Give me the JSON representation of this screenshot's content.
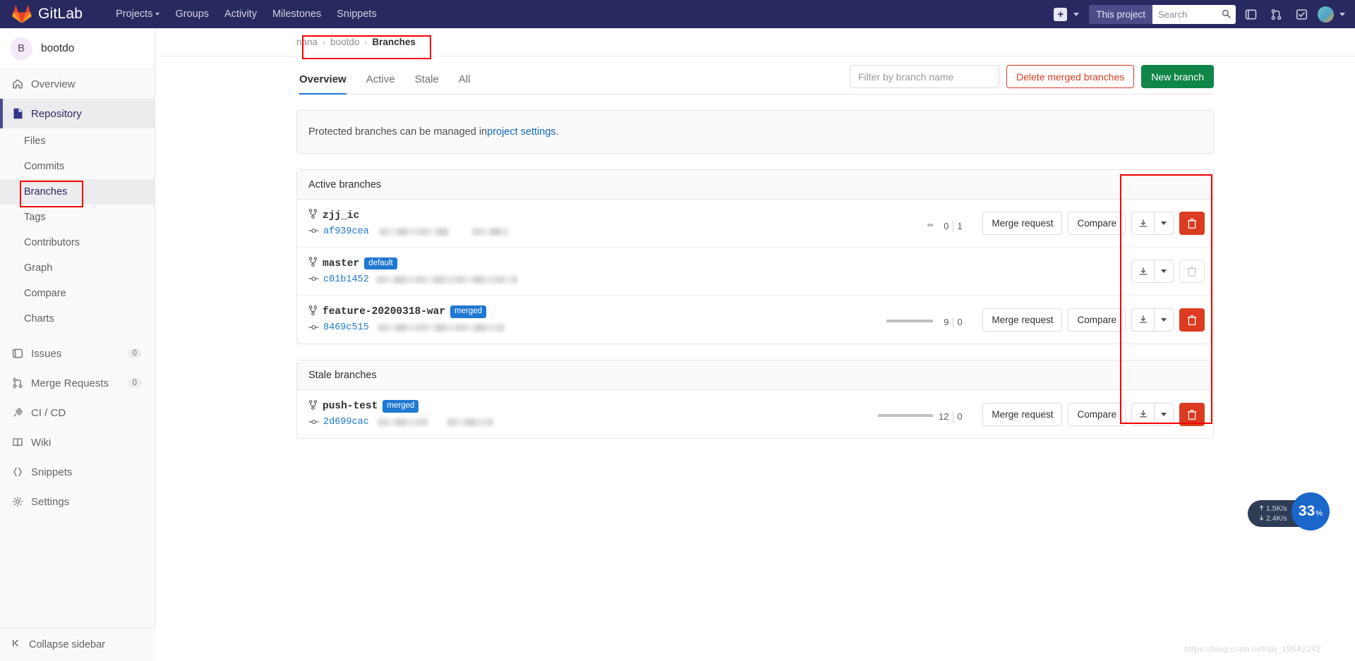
{
  "topnav": {
    "brand": "GitLab",
    "links": [
      {
        "label": "Projects",
        "has_caret": true
      },
      {
        "label": "Groups",
        "has_caret": false
      },
      {
        "label": "Activity",
        "has_caret": false
      },
      {
        "label": "Milestones",
        "has_caret": false
      },
      {
        "label": "Snippets",
        "has_caret": false
      }
    ],
    "plus_icon": "plus-icon",
    "scope_label": "This project",
    "search_placeholder": "Search",
    "icons": [
      "issues-icon",
      "merge-requests-icon",
      "todos-icon",
      "user-avatar"
    ]
  },
  "sidebar": {
    "project_initial": "B",
    "project_name": "bootdo",
    "items": [
      {
        "label": "Overview",
        "icon": "home-icon",
        "badge": "",
        "type": "top"
      },
      {
        "label": "Repository",
        "icon": "document-icon",
        "badge": "",
        "type": "section"
      },
      {
        "label": "Files",
        "icon": "",
        "badge": "",
        "type": "sub"
      },
      {
        "label": "Commits",
        "icon": "",
        "badge": "",
        "type": "sub"
      },
      {
        "label": "Branches",
        "icon": "",
        "badge": "",
        "type": "sub-current"
      },
      {
        "label": "Tags",
        "icon": "",
        "badge": "",
        "type": "sub"
      },
      {
        "label": "Contributors",
        "icon": "",
        "badge": "",
        "type": "sub"
      },
      {
        "label": "Graph",
        "icon": "",
        "badge": "",
        "type": "sub"
      },
      {
        "label": "Compare",
        "icon": "",
        "badge": "",
        "type": "sub"
      },
      {
        "label": "Charts",
        "icon": "",
        "badge": "",
        "type": "sub"
      },
      {
        "label": "Issues",
        "icon": "issues-icon",
        "badge": "0",
        "type": "top"
      },
      {
        "label": "Merge Requests",
        "icon": "merge-icon",
        "badge": "0",
        "type": "top"
      },
      {
        "label": "CI / CD",
        "icon": "rocket-icon",
        "badge": "",
        "type": "top"
      },
      {
        "label": "Wiki",
        "icon": "book-icon",
        "badge": "",
        "type": "top"
      },
      {
        "label": "Snippets",
        "icon": "snippet-icon",
        "badge": "",
        "type": "top"
      },
      {
        "label": "Settings",
        "icon": "gear-icon",
        "badge": "",
        "type": "top"
      }
    ],
    "collapse_label": "Collapse sidebar"
  },
  "breadcrumb": {
    "group": "nana",
    "project": "bootdo",
    "current": "Branches",
    "sep": "›"
  },
  "tabs": [
    {
      "label": "Overview",
      "active": true
    },
    {
      "label": "Active",
      "active": false
    },
    {
      "label": "Stale",
      "active": false
    },
    {
      "label": "All",
      "active": false
    }
  ],
  "toolbar": {
    "filter_placeholder": "Filter by branch name",
    "delete_merged_label": "Delete merged branches",
    "new_branch_label": "New branch"
  },
  "notice": {
    "text_before": "Protected branches can be managed in ",
    "link": "project settings",
    "text_after": "."
  },
  "sections": [
    {
      "title": "Active branches",
      "branches": [
        {
          "name": "zjj_ic",
          "badge": "",
          "sha": "af939cea",
          "behind": "0",
          "ahead": "1",
          "bar_behind_pct": 0,
          "bar_ahead_pct": 8,
          "merge_request_label": "Merge request",
          "compare_label": "Compare",
          "delete_enabled": true
        },
        {
          "name": "master",
          "badge": "default",
          "sha": "c01b1452",
          "behind": "",
          "ahead": "",
          "bar_behind_pct": 0,
          "bar_ahead_pct": 0,
          "merge_request_label": "",
          "compare_label": "",
          "delete_enabled": false
        },
        {
          "name": "feature-20200318-war",
          "badge": "merged",
          "sha": "8469c515",
          "behind": "9",
          "ahead": "0",
          "bar_behind_pct": 55,
          "bar_ahead_pct": 0,
          "merge_request_label": "Merge request",
          "compare_label": "Compare",
          "delete_enabled": true
        }
      ]
    },
    {
      "title": "Stale branches",
      "branches": [
        {
          "name": "push-test",
          "badge": "merged",
          "sha": "2d699cac",
          "behind": "12",
          "ahead": "0",
          "bar_behind_pct": 62,
          "bar_ahead_pct": 0,
          "merge_request_label": "Merge request",
          "compare_label": "Compare",
          "delete_enabled": true
        }
      ]
    }
  ],
  "netspeed": {
    "up": "1.5K/s",
    "down": "2.4K/s",
    "percent": "33",
    "percent_symbol": "%"
  },
  "watermark": "https://blog.csdn.net/qq_19642242",
  "colors": {
    "nav_bg": "#292961",
    "accent_blue": "#1f78d1",
    "danger": "#db3b21",
    "success": "#108548",
    "annotation_red": "#f60000"
  }
}
